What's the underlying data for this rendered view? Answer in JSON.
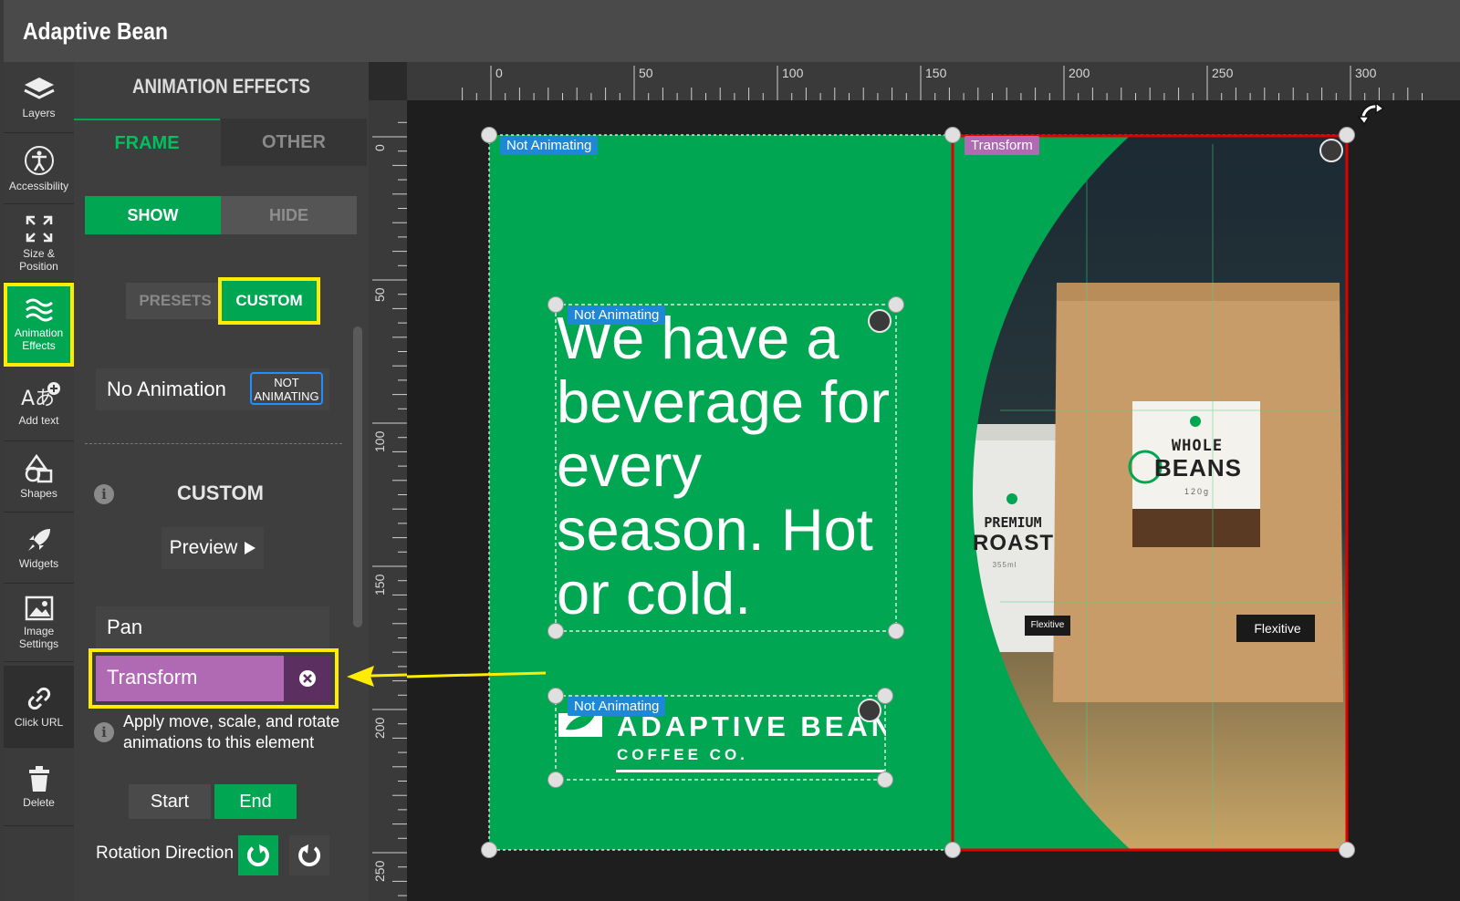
{
  "app": {
    "title": "Adaptive Bean"
  },
  "rail": {
    "items": [
      {
        "label": "Layers",
        "icon": "layers-icon"
      },
      {
        "label": "Accessibility",
        "icon": "accessibility-icon"
      },
      {
        "label": "Size & Position",
        "icon": "resize-icon"
      },
      {
        "label": "Animation Effects",
        "icon": "waves-icon",
        "active": true
      },
      {
        "label": "Add text",
        "icon": "add-text-icon"
      },
      {
        "label": "Shapes",
        "icon": "shapes-icon"
      },
      {
        "label": "Widgets",
        "icon": "rocket-icon"
      },
      {
        "label": "Image Settings",
        "icon": "image-icon"
      },
      {
        "label": "Click URL",
        "icon": "link-icon"
      },
      {
        "label": "Delete",
        "icon": "trash-icon"
      }
    ]
  },
  "panel": {
    "title": "ANIMATION EFFECTS",
    "tabs": {
      "frame": "FRAME",
      "other": "OTHER",
      "active": "FRAME"
    },
    "show": "SHOW",
    "hide": "HIDE",
    "presets": "PRESETS",
    "custom": "CUSTOM",
    "no_animation": {
      "label": "No Animation",
      "badge": "NOT ANIMATING"
    },
    "custom_heading": "CUSTOM",
    "preview": "Preview",
    "pan": "Pan",
    "transform": "Transform",
    "help": "Apply move, scale, and rotate animations to this element",
    "start": "Start",
    "end": "End",
    "rotation_direction": "Rotation Direction"
  },
  "rulers": {
    "horizontal": [
      "0",
      "50",
      "100",
      "150",
      "200",
      "250",
      "300"
    ],
    "vertical": [
      "0",
      "50",
      "100",
      "150",
      "200",
      "250"
    ]
  },
  "canvas": {
    "tags": {
      "frame": "Not Animating",
      "image": "Transform",
      "headline": "Not Animating",
      "logo": "Not Animating"
    },
    "headline": "We have a beverage for every season. Hot or cold.",
    "logo": {
      "name": "ADAPTIVE BEAN",
      "tagline": "COFFEE CO."
    },
    "product": {
      "bag_line1": "WHOLE",
      "bag_line2": "BEANS",
      "bag_weight": "120g",
      "bag_brand": "Flexitive",
      "cup_line1": "PREMIUM",
      "cup_line2": "ROAST",
      "cup_size": "355ml",
      "cup_brand": "Flexitive"
    },
    "colors": {
      "brand_green": "#00a651",
      "transform_purple": "#b06ab3",
      "tag_blue": "#1e88d6",
      "highlight_yellow": "#ffec00",
      "selection_red": "#e00000"
    }
  }
}
